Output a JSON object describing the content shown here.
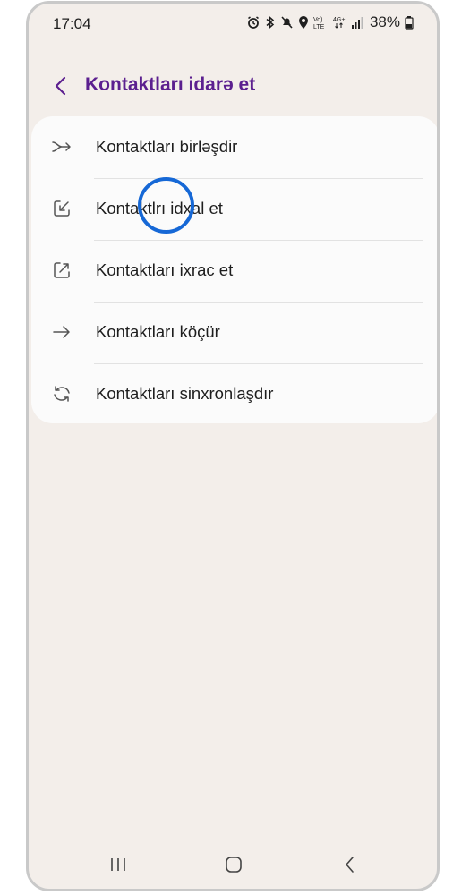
{
  "status_bar": {
    "time": "17:04",
    "battery": "38%",
    "icons": [
      "alarm-icon",
      "bluetooth-icon",
      "mute-icon",
      "location-icon",
      "volte-icon",
      "4g-icon",
      "signal-icon",
      "battery-icon"
    ],
    "volte_label": "Vo) LTE",
    "network_label": "4G+"
  },
  "header": {
    "title": "Kontaktları idarə et",
    "back_icon": "chevron-left-icon",
    "accent_color": "#5b1f8f"
  },
  "menu": {
    "items": [
      {
        "label": "Kontaktları birləşdir",
        "icon": "merge-icon"
      },
      {
        "label": "Kontaktlrı idxal et",
        "icon": "import-icon"
      },
      {
        "label": "Kontaktları ixrac et",
        "icon": "export-icon"
      },
      {
        "label": "Kontaktları köçür",
        "icon": "arrow-right-icon"
      },
      {
        "label": "Kontaktları sinxronlaşdır",
        "icon": "sync-icon"
      }
    ]
  },
  "highlight": {
    "target": "Kontaktlrı idxal et",
    "color": "#1668d6"
  },
  "nav_bar": {
    "buttons": [
      "recents-icon",
      "home-icon",
      "back-icon"
    ]
  }
}
